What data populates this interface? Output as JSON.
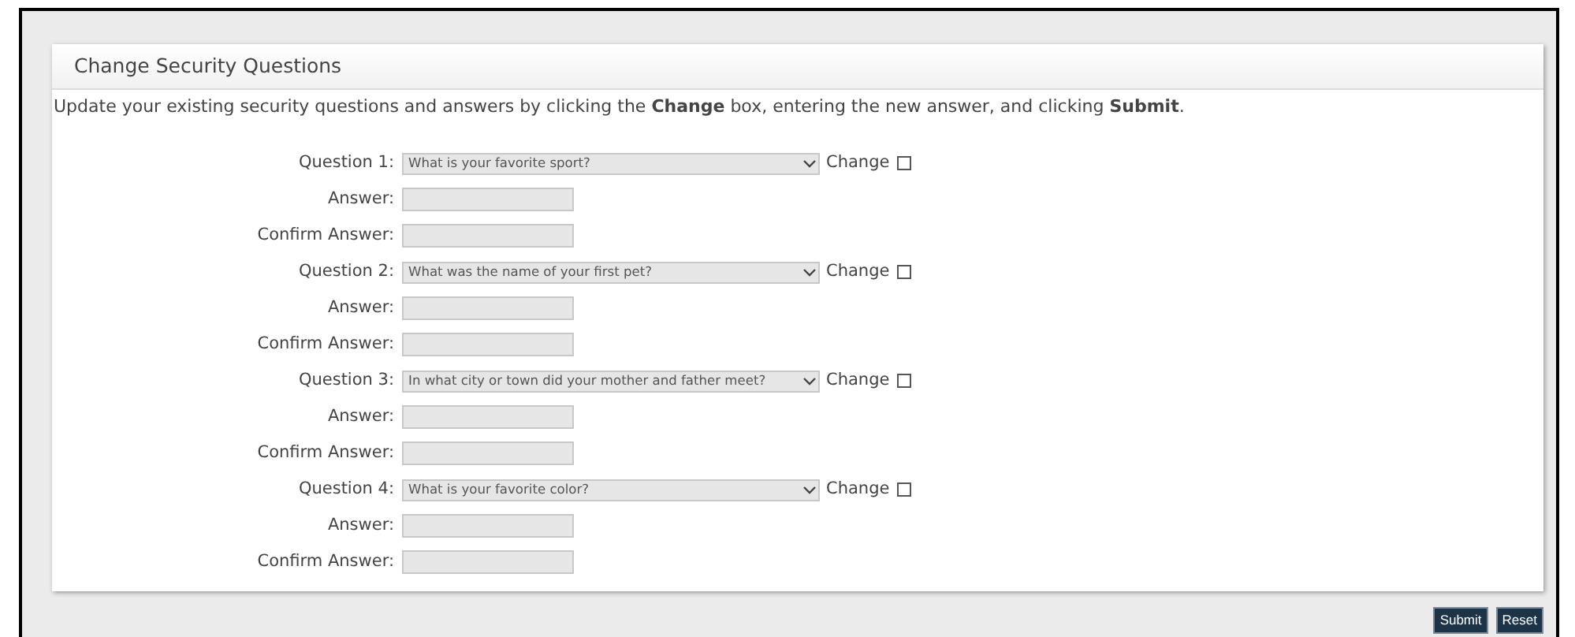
{
  "panel": {
    "title": "Change Security Questions",
    "description": "Update your existing security questions and answers by clicking the **Change** box, entering the new answer, and clicking **Submit**."
  },
  "questions": [
    {
      "label": "Question 1:",
      "value": "What is your favorite sport?",
      "change_label": "Change",
      "checked": false,
      "answer_label": "Answer:",
      "confirm_label": "Confirm Answer:"
    },
    {
      "label": "Question 2:",
      "value": "What was the name of your first pet?",
      "change_label": "Change",
      "checked": false,
      "answer_label": "Answer:",
      "confirm_label": "Confirm Answer:"
    },
    {
      "label": "Question 3:",
      "value": "In what city or town did your mother and father meet?",
      "change_label": "Change",
      "checked": false,
      "answer_label": "Answer:",
      "confirm_label": "Confirm Answer:"
    },
    {
      "label": "Question 4:",
      "value": "What is your favorite color?",
      "change_label": "Change",
      "checked": false,
      "answer_label": "Answer:",
      "confirm_label": "Confirm Answer:"
    }
  ],
  "buttons": [
    "Submit",
    "Reset"
  ]
}
